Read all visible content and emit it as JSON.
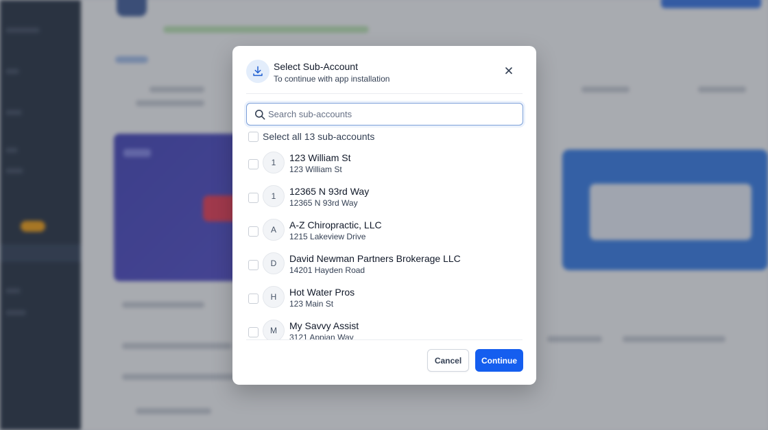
{
  "modal": {
    "title": "Select Sub-Account",
    "subtitle": "To continue with app installation",
    "header_icon": "download-icon",
    "close_icon": "close-icon"
  },
  "search": {
    "placeholder": "Search sub-accounts",
    "value": "",
    "icon": "search-icon"
  },
  "select_all": {
    "label": "Select all 13 sub-accounts",
    "checked": false
  },
  "accounts": [
    {
      "initial": "1",
      "name": "123 William St",
      "address": "123 William St",
      "checked": false
    },
    {
      "initial": "1",
      "name": "12365 N 93rd Way",
      "address": "12365 N 93rd Way",
      "checked": false
    },
    {
      "initial": "A",
      "name": "A-Z Chiropractic, LLC",
      "address": "1215 Lakeview Drive",
      "checked": false
    },
    {
      "initial": "D",
      "name": "David Newman Partners Brokerage LLC",
      "address": "14201 Hayden Road",
      "checked": false
    },
    {
      "initial": "H",
      "name": "Hot Water Pros",
      "address": "123 Main St",
      "checked": false
    },
    {
      "initial": "M",
      "name": "My Savvy Assist",
      "address": "3121 Appian Way",
      "checked": false
    }
  ],
  "footer": {
    "cancel_label": "Cancel",
    "continue_label": "Continue"
  },
  "colors": {
    "primary": "#155eef",
    "overlay": "rgba(60,64,74,0.42)",
    "sidebar": "#1e2a3c"
  }
}
